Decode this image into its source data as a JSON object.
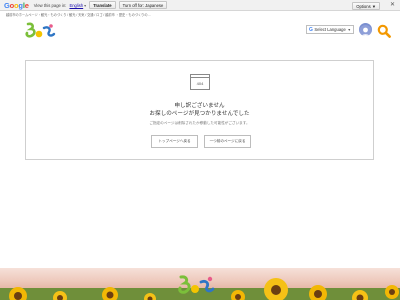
{
  "translate_bar": {
    "prompt": "View this page in:",
    "language": "English",
    "translate_label": "Translate",
    "turn_off_label": "Turn off for: Japanese",
    "options_label": "Options ▼",
    "close_label": "✕"
  },
  "breadcrumbs": "越前市のホームページ・観光・ものづくり / 観光 / 天気 / 交通 / ロゴ / 越前市 ・歴史・ものづくりの…",
  "header": {
    "language_selector": "Select Language"
  },
  "error": {
    "icon_text": "404",
    "title_line1": "申し訳ございません",
    "title_line2": "お探しのページが見つかりませんでした",
    "subtext": "ご指定のページは削除されたか移動した可能性がございます。",
    "button_top": "トップページへ戻る",
    "button_back": "一つ前のページに戻る"
  },
  "colors": {
    "accent_green": "#7bbf3a",
    "accent_blue": "#2f76c5",
    "search_orange": "#f39800"
  }
}
